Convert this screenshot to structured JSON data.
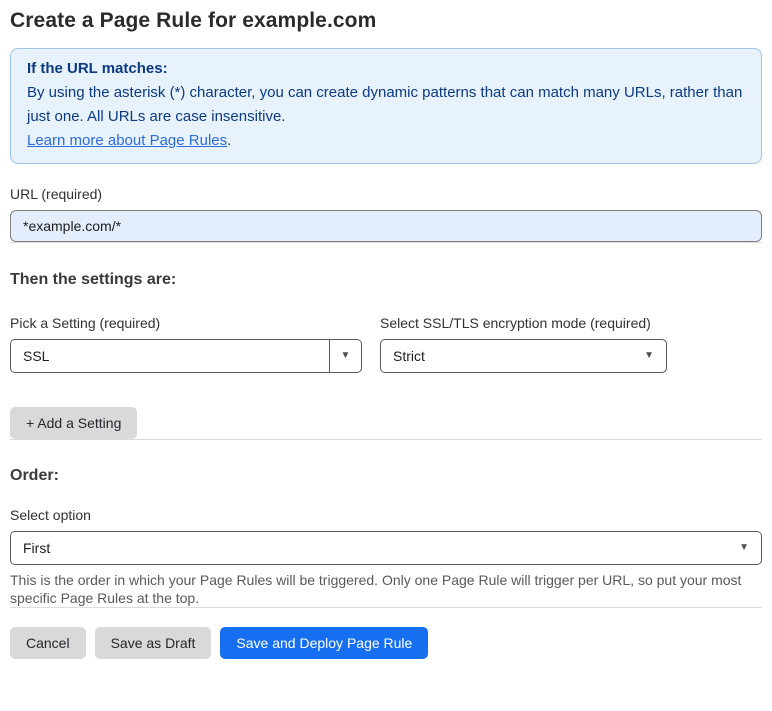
{
  "page": {
    "title": "Create a Page Rule for example.com"
  },
  "info_box": {
    "heading": "If the URL matches:",
    "body": "By using the asterisk (*) character, you can create dynamic patterns that can match many URLs, rather than just one. All URLs are case insensitive.",
    "link": "Learn more about Page Rules",
    "link_suffix": "."
  },
  "url_field": {
    "label": "URL (required)",
    "value": "*example.com/*"
  },
  "settings_section": {
    "heading": "Then the settings are:",
    "setting_picker": {
      "label": "Pick a Setting (required)",
      "value": "SSL"
    },
    "ssl_mode": {
      "label": "Select SSL/TLS encryption mode (required)",
      "value": "Strict"
    },
    "add_setting_label": "+ Add a Setting"
  },
  "order_section": {
    "heading": "Order:",
    "select_label": "Select option",
    "value": "First",
    "help_text": "This is the order in which your Page Rules will be triggered. Only one Page Rule will trigger per URL, so put your most specific Page Rules at the top."
  },
  "footer": {
    "cancel_label": "Cancel",
    "save_draft_label": "Save as Draft",
    "save_deploy_label": "Save and Deploy Page Rule"
  },
  "icons": {
    "chevron_down": "▼"
  },
  "colors": {
    "accent_blue": "#166ff0",
    "info_bg": "#e8f2fc",
    "info_border": "#9dc3ea",
    "info_text": "#0b3a82",
    "link_blue": "#2b6cd9",
    "input_bg": "#e3edfb",
    "button_gray": "#d9d9d9",
    "divider": "#dcdcdc"
  }
}
